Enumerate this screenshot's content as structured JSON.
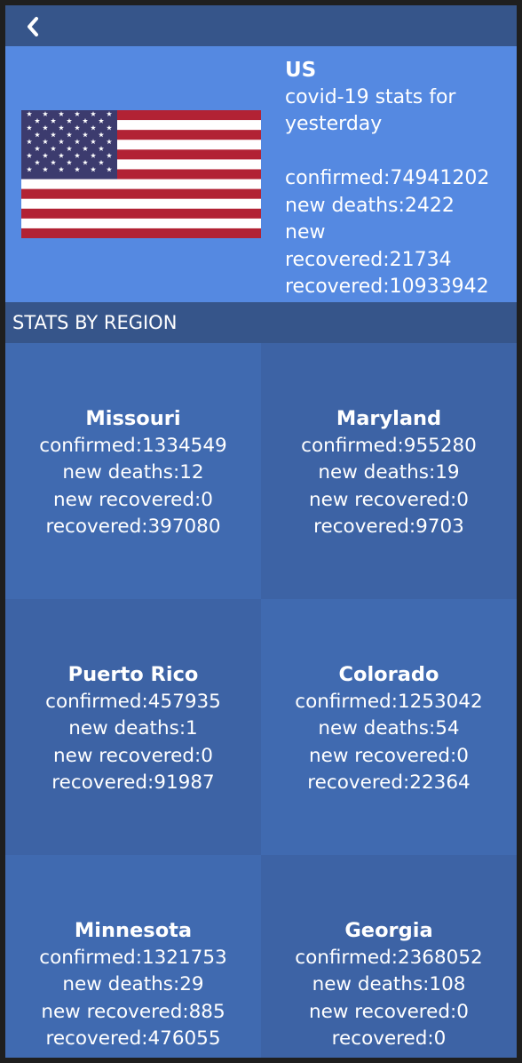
{
  "nav": {
    "back_icon": "chevron-left-icon"
  },
  "country": {
    "name": "US",
    "subtitle_line1": "covid-19 stats for",
    "subtitle_line2": "yesterday",
    "confirmed": "confirmed:74941202",
    "new_deaths": "new deaths:2422",
    "new_recovered_line1": "new",
    "new_recovered_line2": "recovered:21734",
    "recovered": "recovered:10933942",
    "flag_icon": "us-flag-icon"
  },
  "section": {
    "title": "STATS BY REGION"
  },
  "regions": [
    {
      "name": "Missouri",
      "confirmed": "confirmed:1334549",
      "new_deaths": "new deaths:12",
      "new_recovered": "new recovered:0",
      "recovered": "recovered:397080"
    },
    {
      "name": "Maryland",
      "confirmed": "confirmed:955280",
      "new_deaths": "new deaths:19",
      "new_recovered": "new recovered:0",
      "recovered": "recovered:9703"
    },
    {
      "name": "Puerto Rico",
      "confirmed": "confirmed:457935",
      "new_deaths": "new deaths:1",
      "new_recovered": "new recovered:0",
      "recovered": "recovered:91987"
    },
    {
      "name": "Colorado",
      "confirmed": "confirmed:1253042",
      "new_deaths": "new deaths:54",
      "new_recovered": "new recovered:0",
      "recovered": "recovered:22364"
    },
    {
      "name": "Minnesota",
      "confirmed": "confirmed:1321753",
      "new_deaths": "new deaths:29",
      "new_recovered": "new recovered:885",
      "recovered": "recovered:476055"
    },
    {
      "name": "Georgia",
      "confirmed": "confirmed:2368052",
      "new_deaths": "new deaths:108",
      "new_recovered": "new recovered:0",
      "recovered": "recovered:0"
    }
  ],
  "colors": {
    "topbar": "#36558a",
    "hero": "#5589e1",
    "tile_light": "#406ab0",
    "tile_dark": "#3d63a5",
    "flag_red": "#b22234",
    "flag_blue": "#3c3b6e",
    "text": "#ffffff"
  }
}
